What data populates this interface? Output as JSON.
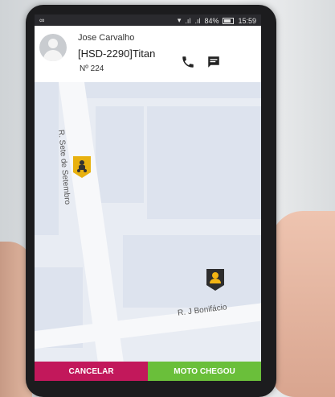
{
  "status_bar": {
    "left_glyph": "∞",
    "battery": "84%",
    "time": "15:59"
  },
  "driver": {
    "name": "Jose Carvalho",
    "vehicle": "[HSD-2290]Titan",
    "number": "Nº 224"
  },
  "map": {
    "street_vertical": "R. Sete de Setembro",
    "street_horizontal": "R. J Bonifácio"
  },
  "actions": {
    "cancel": "CANCELAR",
    "arrived": "MOTO CHEGOU"
  },
  "colors": {
    "cancel": "#c2185b",
    "arrived": "#6abf3a",
    "pin_moto": "#e8b10f",
    "pin_user": "#2d2d2d"
  }
}
